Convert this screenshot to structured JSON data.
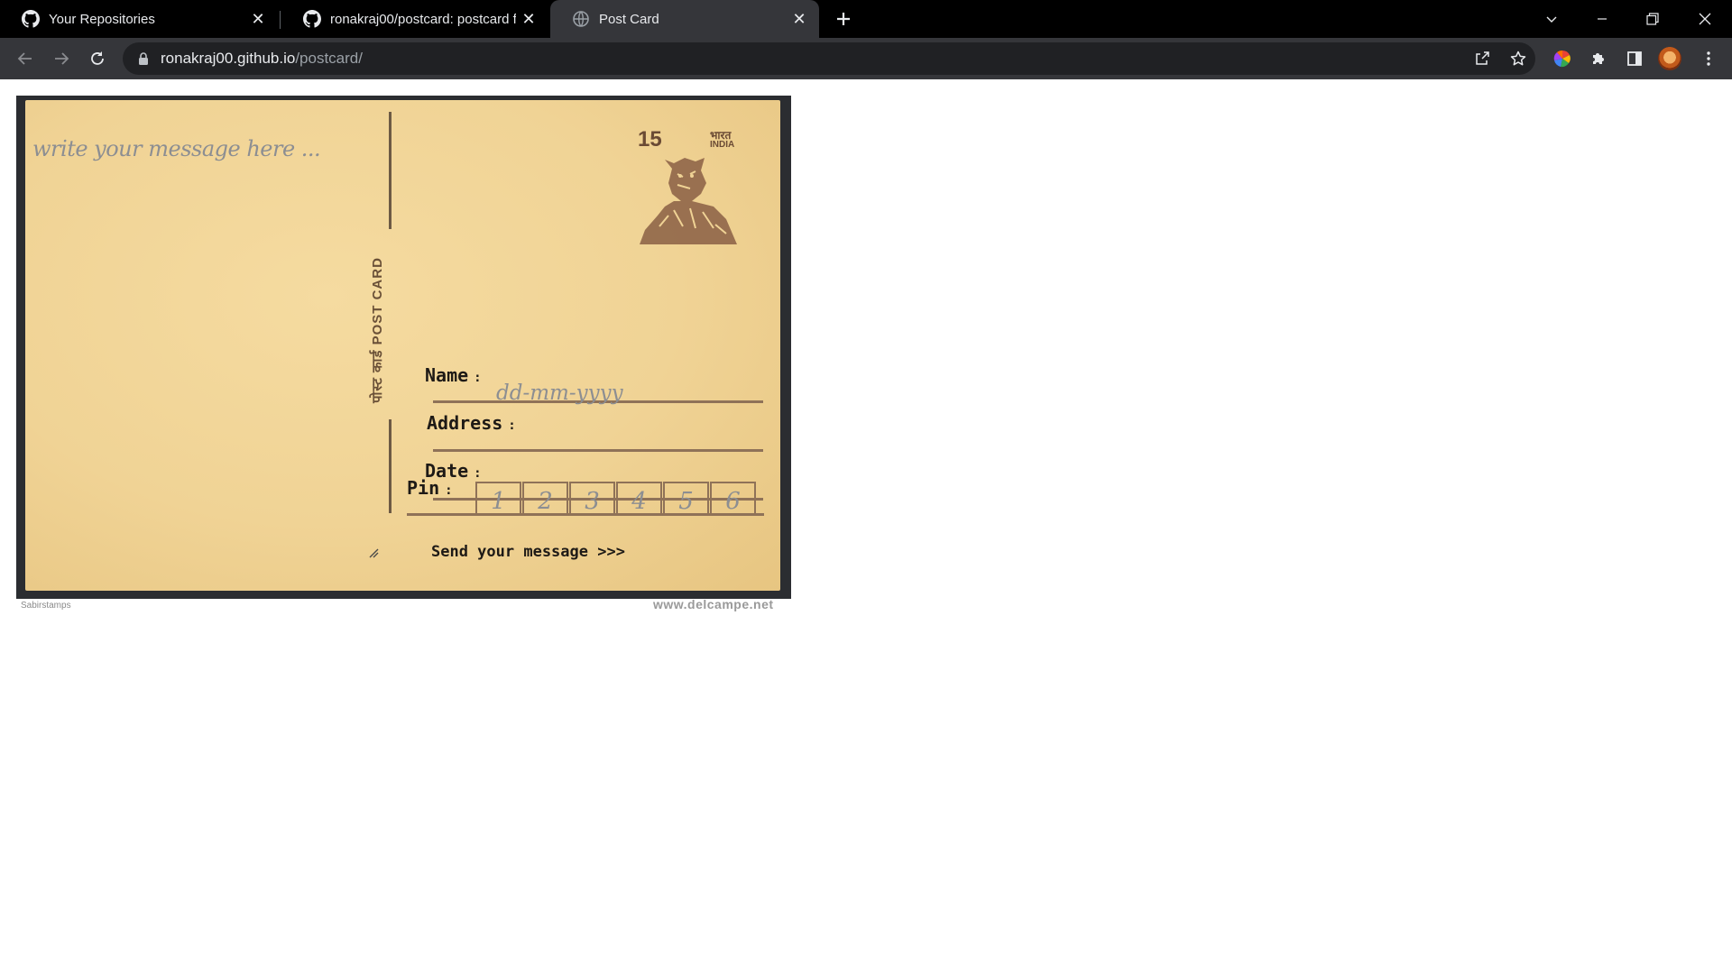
{
  "browser": {
    "tabs": [
      {
        "title": "Your Repositories",
        "icon": "github-icon",
        "active": false
      },
      {
        "title": "ronakraj00/postcard: postcard for",
        "icon": "github-icon",
        "active": false
      },
      {
        "title": "Post Card",
        "icon": "globe-icon",
        "active": true
      }
    ],
    "new_tab": "+",
    "address": {
      "host": "ronakraj00.github.io",
      "path": "/postcard/"
    }
  },
  "postcard": {
    "message_placeholder": "write your message here ...",
    "vertical_label": "पोस्ट कार्ड POST CARD",
    "stamp": {
      "value": "15",
      "country_hindi": "भारत",
      "country": "INDIA"
    },
    "name_label": "Name",
    "address_label": "Address",
    "date_label": "Date",
    "date_placeholder": "dd-mm-yyyy",
    "pin_label": "Pin",
    "pin_placeholders": [
      "1",
      "2",
      "3",
      "4",
      "5",
      "6"
    ],
    "send_label": "Send your message >>>",
    "colon": ":"
  },
  "credits": {
    "left": "Sabirstamps",
    "right": "www.delcampe.net"
  }
}
